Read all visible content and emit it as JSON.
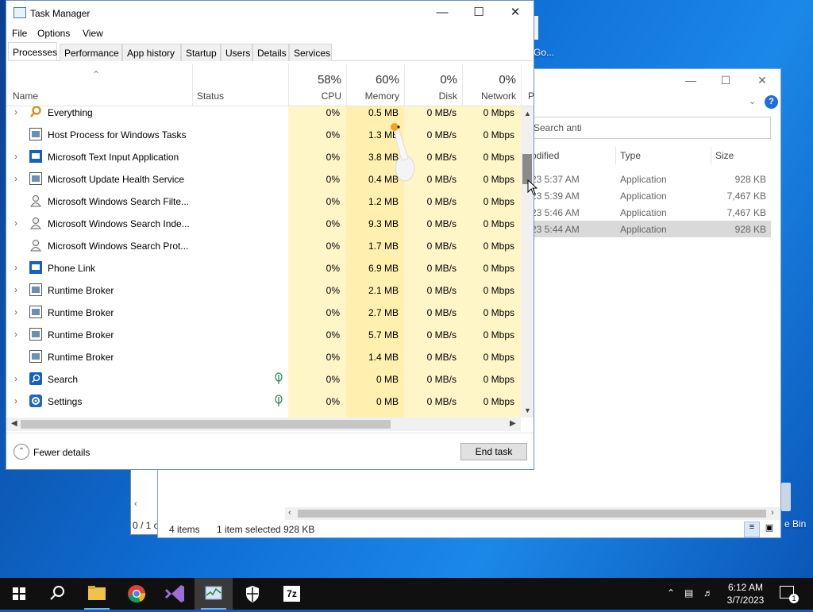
{
  "desktop": {
    "label_go": "Go...",
    "recycle_label": "e Bin"
  },
  "explorer": {
    "search_placeholder": "Search anti",
    "columns": {
      "modified": "odified",
      "type": "Type",
      "size": "Size"
    },
    "rows": [
      {
        "modified": "23 5:37 AM",
        "type": "Application",
        "size": "928 KB",
        "selected": false
      },
      {
        "modified": "23 5:39 AM",
        "type": "Application",
        "size": "7,467 KB",
        "selected": false
      },
      {
        "modified": "23 5:46 AM",
        "type": "Application",
        "size": "7,467 KB",
        "selected": false
      },
      {
        "modified": "23 5:44 AM",
        "type": "Application",
        "size": "928 KB",
        "selected": true
      }
    ],
    "status": {
      "items": "4 items",
      "selected": "1 item selected",
      "size": "928 KB"
    },
    "back_count": "0 / 1 o"
  },
  "taskmgr": {
    "title": "Task Manager",
    "menu": [
      "File",
      "Options",
      "View"
    ],
    "tabs": [
      "Processes",
      "Performance",
      "App history",
      "Startup",
      "Users",
      "Details",
      "Services"
    ],
    "columns": {
      "name": "Name",
      "status": "Status",
      "cpu": {
        "pct": "58%",
        "label": "CPU"
      },
      "memory": {
        "pct": "60%",
        "label": "Memory"
      },
      "disk": {
        "pct": "0%",
        "label": "Disk"
      },
      "network": {
        "pct": "0%",
        "label": "Network"
      },
      "power": "P"
    },
    "processes": [
      {
        "name": "Everything",
        "expand": true,
        "icon": "magnifier-icon",
        "eco": false,
        "cpu": "0%",
        "mem": "0.5 MB",
        "disk": "0 MB/s",
        "net": "0 Mbps"
      },
      {
        "name": "Host Process for Windows Tasks",
        "expand": false,
        "icon": "window-icon",
        "eco": false,
        "cpu": "0%",
        "mem": "1.3 MB",
        "disk": "0 MB/s",
        "net": "0 Mbps"
      },
      {
        "name": "Microsoft Text Input Application",
        "expand": true,
        "icon": "blue-app-icon",
        "eco": false,
        "cpu": "0%",
        "mem": "3.8 MB",
        "disk": "0 MB/s",
        "net": "0 Mbps"
      },
      {
        "name": "Microsoft Update Health Service",
        "expand": true,
        "icon": "window-icon",
        "eco": false,
        "cpu": "0%",
        "mem": "0.4 MB",
        "disk": "0 MB/s",
        "net": "0 Mbps"
      },
      {
        "name": "Microsoft Windows Search Filte...",
        "expand": false,
        "icon": "user-icon",
        "eco": false,
        "cpu": "0%",
        "mem": "1.2 MB",
        "disk": "0 MB/s",
        "net": "0 Mbps"
      },
      {
        "name": "Microsoft Windows Search Inde...",
        "expand": true,
        "icon": "user-icon",
        "eco": false,
        "cpu": "0%",
        "mem": "9.3 MB",
        "disk": "0 MB/s",
        "net": "0 Mbps"
      },
      {
        "name": "Microsoft Windows Search Prot...",
        "expand": false,
        "icon": "user-icon",
        "eco": false,
        "cpu": "0%",
        "mem": "1.7 MB",
        "disk": "0 MB/s",
        "net": "0 Mbps"
      },
      {
        "name": "Phone Link",
        "expand": true,
        "icon": "blue-app-icon",
        "eco": false,
        "cpu": "0%",
        "mem": "6.9 MB",
        "disk": "0 MB/s",
        "net": "0 Mbps"
      },
      {
        "name": "Runtime Broker",
        "expand": true,
        "icon": "window-icon",
        "eco": false,
        "cpu": "0%",
        "mem": "2.1 MB",
        "disk": "0 MB/s",
        "net": "0 Mbps"
      },
      {
        "name": "Runtime Broker",
        "expand": true,
        "icon": "window-icon",
        "eco": false,
        "cpu": "0%",
        "mem": "2.7 MB",
        "disk": "0 MB/s",
        "net": "0 Mbps"
      },
      {
        "name": "Runtime Broker",
        "expand": true,
        "icon": "window-icon",
        "eco": false,
        "cpu": "0%",
        "mem": "5.7 MB",
        "disk": "0 MB/s",
        "net": "0 Mbps"
      },
      {
        "name": "Runtime Broker",
        "expand": false,
        "icon": "window-icon",
        "eco": false,
        "cpu": "0%",
        "mem": "1.4 MB",
        "disk": "0 MB/s",
        "net": "0 Mbps"
      },
      {
        "name": "Search",
        "expand": true,
        "icon": "search-icon",
        "eco": true,
        "cpu": "0%",
        "mem": "0 MB",
        "disk": "0 MB/s",
        "net": "0 Mbps"
      },
      {
        "name": "Settings",
        "expand": true,
        "icon": "gear-icon",
        "eco": true,
        "cpu": "0%",
        "mem": "0 MB",
        "disk": "0 MB/s",
        "net": "0 Mbps"
      }
    ],
    "fewer_details": "Fewer details",
    "end_task": "End task"
  },
  "taskbar": {
    "time": "6:12 AM",
    "date": "3/7/2023",
    "notification_count": "1",
    "apps": [
      "start-icon",
      "search-icon",
      "file-explorer-icon",
      "chrome-icon",
      "visual-studio-icon",
      "task-manager-icon",
      "security-icon",
      "7zip-icon"
    ],
    "sevenzip_label": "7z"
  }
}
